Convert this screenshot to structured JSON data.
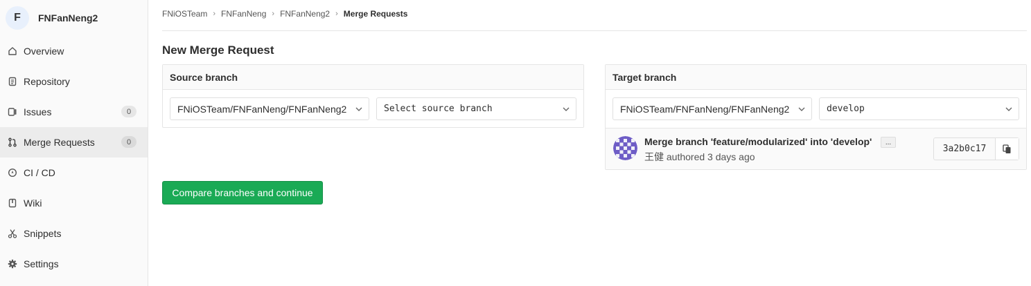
{
  "sidebar": {
    "project_initial": "F",
    "project_name": "FNFanNeng2",
    "items": [
      {
        "label": "Overview",
        "icon": "home-icon"
      },
      {
        "label": "Repository",
        "icon": "doc-icon"
      },
      {
        "label": "Issues",
        "icon": "issues-icon",
        "badge": "0"
      },
      {
        "label": "Merge Requests",
        "icon": "merge-request-icon",
        "badge": "0",
        "active": true
      },
      {
        "label": "CI / CD",
        "icon": "rocket-icon"
      },
      {
        "label": "Wiki",
        "icon": "book-icon"
      },
      {
        "label": "Snippets",
        "icon": "scissors-icon"
      },
      {
        "label": "Settings",
        "icon": "gear-icon"
      }
    ]
  },
  "breadcrumb": {
    "items": [
      "FNiOSTeam",
      "FNFanNeng",
      "FNFanNeng2"
    ],
    "current": "Merge Requests"
  },
  "page_title": "New Merge Request",
  "source": {
    "header": "Source branch",
    "project": "FNiOSTeam/FNFanNeng/FNFanNeng2",
    "branch_placeholder": "Select source branch"
  },
  "target": {
    "header": "Target branch",
    "project": "FNiOSTeam/FNFanNeng/FNFanNeng2",
    "branch": "develop"
  },
  "commit": {
    "title": "Merge branch 'feature/modularized' into 'develop'",
    "ellipsis": "...",
    "author_line": "王健 authored 3 days ago",
    "sha": "3a2b0c17"
  },
  "compare_button": "Compare branches and continue",
  "colors": {
    "accent_green": "#1aaa55",
    "avatar_purple": "#6e5dc6"
  }
}
